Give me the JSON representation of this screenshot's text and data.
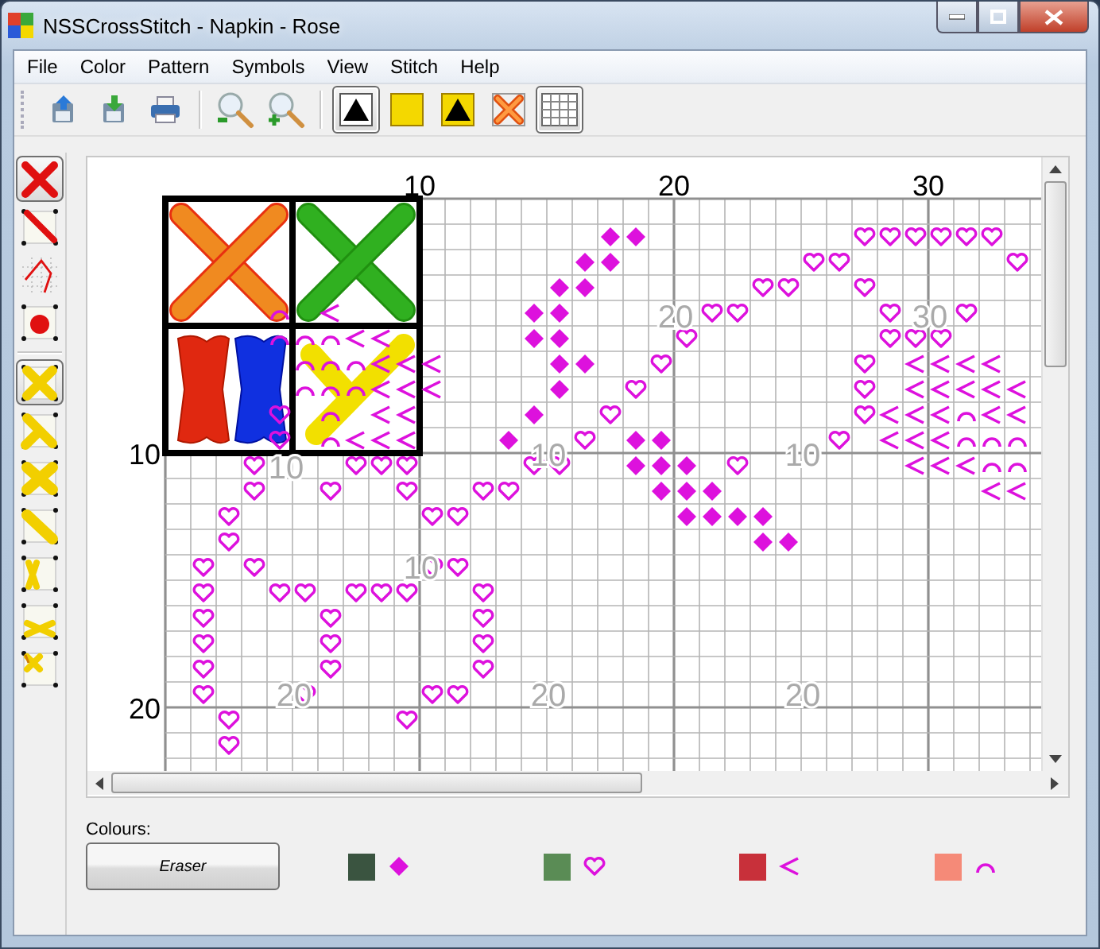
{
  "window": {
    "title": "NSSCrossStitch - Napkin - Rose"
  },
  "menu": [
    {
      "label": "File"
    },
    {
      "label": "Color"
    },
    {
      "label": "Pattern"
    },
    {
      "label": "Symbols"
    },
    {
      "label": "View"
    },
    {
      "label": "Stitch"
    },
    {
      "label": "Help"
    }
  ],
  "toolbar": {
    "file_buttons": [
      {
        "kind": "open"
      },
      {
        "kind": "save"
      },
      {
        "kind": "print"
      }
    ],
    "zoom_buttons": [
      {
        "kind": "zoom-out"
      },
      {
        "kind": "zoom-in"
      }
    ],
    "view_buttons": [
      {
        "kind": "symbol",
        "selected": true
      },
      {
        "kind": "colour",
        "selected": false
      },
      {
        "kind": "colour-symbol",
        "selected": false
      },
      {
        "kind": "stitch",
        "selected": false
      },
      {
        "kind": "grid",
        "selected": true
      }
    ]
  },
  "line_tools": [
    {
      "kind": "full-cross",
      "selected": true
    },
    {
      "kind": "diagonal-line",
      "selected": false
    },
    {
      "kind": "backstitch",
      "selected": false
    },
    {
      "kind": "knot",
      "selected": false
    }
  ],
  "stitch_tools": [
    {
      "kind": "full",
      "selected": true
    },
    {
      "kind": "three-quarter",
      "selected": false
    },
    {
      "kind": "full-small",
      "selected": false
    },
    {
      "kind": "half",
      "selected": false
    },
    {
      "kind": "quarter-vertical",
      "selected": false
    },
    {
      "kind": "half-horizontal",
      "selected": false
    },
    {
      "kind": "quarter",
      "selected": false
    }
  ],
  "pattern": {
    "column_labels": [
      "10",
      "20",
      "30"
    ],
    "row_labels": [
      "10",
      "20"
    ],
    "overlay_labels": [
      "20",
      "30",
      "10",
      "10",
      "10",
      "10",
      "20",
      "20",
      "20"
    ]
  },
  "colours": {
    "label": "Colours:",
    "eraser": "Eraser",
    "swatches": [
      {
        "color": "#3a5440",
        "kind": "diamond"
      },
      {
        "color": "#5a8c55",
        "kind": "heart"
      },
      {
        "color": "#c8303a",
        "kind": "less-than"
      },
      {
        "color": "#f58a78",
        "kind": "arch"
      }
    ]
  }
}
